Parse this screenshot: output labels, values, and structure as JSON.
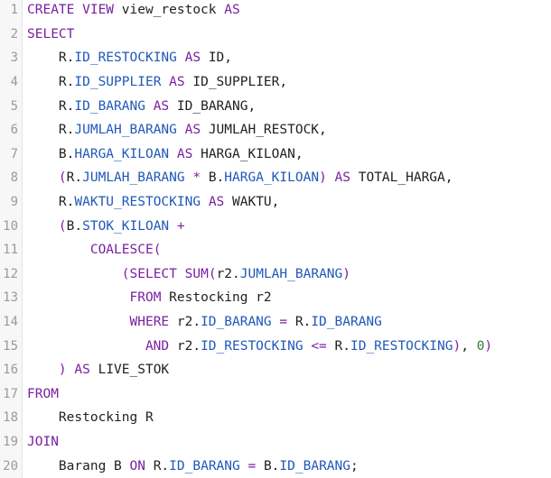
{
  "editor": {
    "lines": [
      {
        "n": "1",
        "indent": "",
        "tokens": [
          {
            "t": "CREATE VIEW",
            "c": "kw"
          },
          {
            "t": " view_restock ",
            "c": "plain"
          },
          {
            "t": "AS",
            "c": "kw"
          }
        ]
      },
      {
        "n": "2",
        "indent": "",
        "tokens": [
          {
            "t": "SELECT",
            "c": "kw"
          }
        ]
      },
      {
        "n": "3",
        "indent": "    ",
        "tokens": [
          {
            "t": "R.",
            "c": "plain"
          },
          {
            "t": "ID_RESTOCKING",
            "c": "ident"
          },
          {
            "t": " ",
            "c": "plain"
          },
          {
            "t": "AS",
            "c": "kw"
          },
          {
            "t": " ID,",
            "c": "plain"
          }
        ]
      },
      {
        "n": "4",
        "indent": "    ",
        "tokens": [
          {
            "t": "R.",
            "c": "plain"
          },
          {
            "t": "ID_SUPPLIER",
            "c": "ident"
          },
          {
            "t": " ",
            "c": "plain"
          },
          {
            "t": "AS",
            "c": "kw"
          },
          {
            "t": " ID_SUPPLIER,",
            "c": "plain"
          }
        ]
      },
      {
        "n": "5",
        "indent": "    ",
        "tokens": [
          {
            "t": "R.",
            "c": "plain"
          },
          {
            "t": "ID_BARANG",
            "c": "ident"
          },
          {
            "t": " ",
            "c": "plain"
          },
          {
            "t": "AS",
            "c": "kw"
          },
          {
            "t": " ID_BARANG,",
            "c": "plain"
          }
        ]
      },
      {
        "n": "6",
        "indent": "    ",
        "tokens": [
          {
            "t": "R.",
            "c": "plain"
          },
          {
            "t": "JUMLAH_BARANG",
            "c": "ident"
          },
          {
            "t": " ",
            "c": "plain"
          },
          {
            "t": "AS",
            "c": "kw"
          },
          {
            "t": " JUMLAH_RESTOCK,",
            "c": "plain"
          }
        ]
      },
      {
        "n": "7",
        "indent": "    ",
        "tokens": [
          {
            "t": "B.",
            "c": "plain"
          },
          {
            "t": "HARGA_KILOAN",
            "c": "ident"
          },
          {
            "t": " ",
            "c": "plain"
          },
          {
            "t": "AS",
            "c": "kw"
          },
          {
            "t": " HARGA_KILOAN,",
            "c": "plain"
          }
        ]
      },
      {
        "n": "8",
        "indent": "    ",
        "tokens": [
          {
            "t": "(",
            "c": "op"
          },
          {
            "t": "R.",
            "c": "plain"
          },
          {
            "t": "JUMLAH_BARANG",
            "c": "ident"
          },
          {
            "t": " ",
            "c": "plain"
          },
          {
            "t": "*",
            "c": "op"
          },
          {
            "t": " B.",
            "c": "plain"
          },
          {
            "t": "HARGA_KILOAN",
            "c": "ident"
          },
          {
            "t": ")",
            "c": "op"
          },
          {
            "t": " ",
            "c": "plain"
          },
          {
            "t": "AS",
            "c": "kw"
          },
          {
            "t": " TOTAL_HARGA,",
            "c": "plain"
          }
        ]
      },
      {
        "n": "9",
        "indent": "    ",
        "tokens": [
          {
            "t": "R.",
            "c": "plain"
          },
          {
            "t": "WAKTU_RESTOCKING",
            "c": "ident"
          },
          {
            "t": " ",
            "c": "plain"
          },
          {
            "t": "AS",
            "c": "kw"
          },
          {
            "t": " WAKTU,",
            "c": "plain"
          }
        ]
      },
      {
        "n": "10",
        "indent": "    ",
        "tokens": [
          {
            "t": "(",
            "c": "op"
          },
          {
            "t": "B.",
            "c": "plain"
          },
          {
            "t": "STOK_KILOAN",
            "c": "ident"
          },
          {
            "t": " ",
            "c": "plain"
          },
          {
            "t": "+",
            "c": "op"
          }
        ]
      },
      {
        "n": "11",
        "indent": "        ",
        "tokens": [
          {
            "t": "COALESCE",
            "c": "kw"
          },
          {
            "t": "(",
            "c": "op"
          }
        ]
      },
      {
        "n": "12",
        "indent": "            ",
        "tokens": [
          {
            "t": "(",
            "c": "op"
          },
          {
            "t": "SELECT",
            "c": "kw"
          },
          {
            "t": " ",
            "c": "plain"
          },
          {
            "t": "SUM",
            "c": "kw"
          },
          {
            "t": "(",
            "c": "op"
          },
          {
            "t": "r2.",
            "c": "plain"
          },
          {
            "t": "JUMLAH_BARANG",
            "c": "ident"
          },
          {
            "t": ")",
            "c": "op"
          }
        ]
      },
      {
        "n": "13",
        "indent": "             ",
        "tokens": [
          {
            "t": "FROM",
            "c": "kw"
          },
          {
            "t": " Restocking r2",
            "c": "plain"
          }
        ]
      },
      {
        "n": "14",
        "indent": "             ",
        "tokens": [
          {
            "t": "WHERE",
            "c": "kw"
          },
          {
            "t": " r2.",
            "c": "plain"
          },
          {
            "t": "ID_BARANG",
            "c": "ident"
          },
          {
            "t": " ",
            "c": "plain"
          },
          {
            "t": "=",
            "c": "op"
          },
          {
            "t": " R.",
            "c": "plain"
          },
          {
            "t": "ID_BARANG",
            "c": "ident"
          }
        ]
      },
      {
        "n": "15",
        "indent": "               ",
        "tokens": [
          {
            "t": "AND",
            "c": "kw"
          },
          {
            "t": " r2.",
            "c": "plain"
          },
          {
            "t": "ID_RESTOCKING",
            "c": "ident"
          },
          {
            "t": " ",
            "c": "plain"
          },
          {
            "t": "<=",
            "c": "op"
          },
          {
            "t": " R.",
            "c": "plain"
          },
          {
            "t": "ID_RESTOCKING",
            "c": "ident"
          },
          {
            "t": ")",
            "c": "op"
          },
          {
            "t": ", ",
            "c": "plain"
          },
          {
            "t": "0",
            "c": "num"
          },
          {
            "t": ")",
            "c": "op"
          }
        ]
      },
      {
        "n": "16",
        "indent": "    ",
        "tokens": [
          {
            "t": ")",
            "c": "op"
          },
          {
            "t": " ",
            "c": "plain"
          },
          {
            "t": "AS",
            "c": "kw"
          },
          {
            "t": " LIVE_STOK",
            "c": "plain"
          }
        ]
      },
      {
        "n": "17",
        "indent": "",
        "tokens": [
          {
            "t": "FROM",
            "c": "kw"
          }
        ]
      },
      {
        "n": "18",
        "indent": "    ",
        "tokens": [
          {
            "t": "Restocking R",
            "c": "plain"
          }
        ]
      },
      {
        "n": "19",
        "indent": "",
        "tokens": [
          {
            "t": "JOIN",
            "c": "kw"
          }
        ]
      },
      {
        "n": "20",
        "indent": "    ",
        "tokens": [
          {
            "t": "Barang B ",
            "c": "plain"
          },
          {
            "t": "ON",
            "c": "kw"
          },
          {
            "t": " R.",
            "c": "plain"
          },
          {
            "t": "ID_BARANG",
            "c": "ident"
          },
          {
            "t": " ",
            "c": "plain"
          },
          {
            "t": "=",
            "c": "op"
          },
          {
            "t": " B.",
            "c": "plain"
          },
          {
            "t": "ID_BARANG",
            "c": "ident"
          },
          {
            "t": ";",
            "c": "plain"
          }
        ]
      }
    ]
  }
}
